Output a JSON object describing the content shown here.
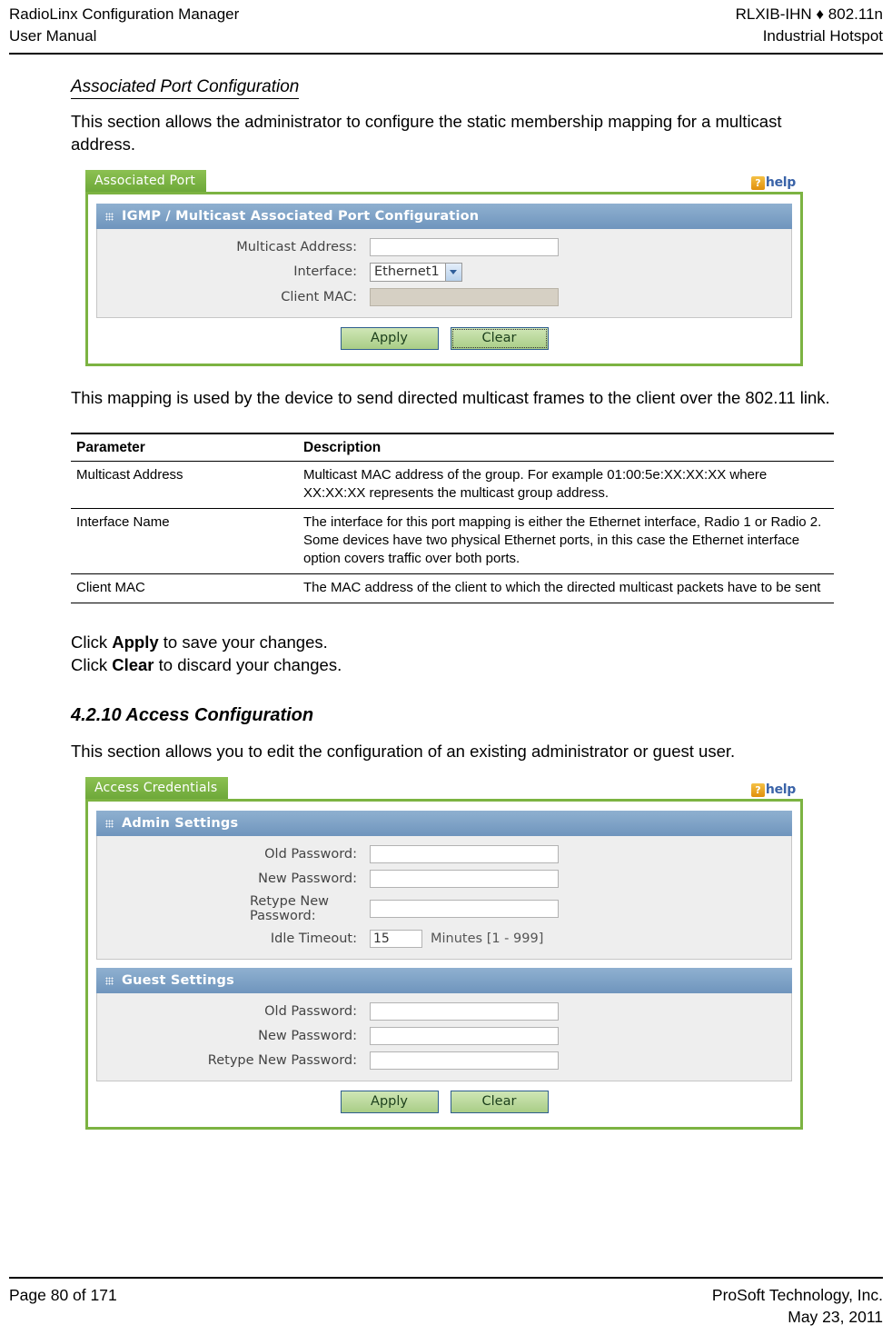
{
  "header": {
    "left_line1": "RadioLinx Configuration Manager",
    "left_line2": "User Manual",
    "right_line1": "RLXIB-IHN ♦ 802.11n",
    "right_line2": "Industrial Hotspot"
  },
  "body": {
    "subheading": "Associated Port Configuration",
    "intro_paragraph": "This section allows the administrator to configure the static membership mapping for a multicast address.",
    "mapping_paragraph": "This mapping is used by the device to send directed multicast frames to the client over the 802.11 link.",
    "click_apply_prefix": "Click ",
    "click_apply_bold": "Apply",
    "click_apply_suffix": " to save your changes.",
    "click_clear_prefix": "Click ",
    "click_clear_bold": "Clear",
    "click_clear_suffix": " to discard your changes.",
    "section_heading": "4.2.10 Access Configuration",
    "access_paragraph": "This section allows you to edit the configuration of an existing administrator or guest user."
  },
  "screenshot_associated_port": {
    "tab_label": "Associated Port",
    "help_badge": "?",
    "help_label": "help",
    "panel_title": "IGMP / Multicast Associated Port Configuration",
    "fields": [
      {
        "label": "Multicast Address:",
        "type": "text",
        "value": "",
        "disabled": false
      },
      {
        "label": "Interface:",
        "type": "select",
        "value": "Ethernet1",
        "disabled": false
      },
      {
        "label": "Client MAC:",
        "type": "text",
        "value": "",
        "disabled": true
      }
    ],
    "buttons": [
      {
        "label": "Apply",
        "focused": false
      },
      {
        "label": "Clear",
        "focused": true
      }
    ]
  },
  "screenshot_access_credentials": {
    "tab_label": "Access Credentials",
    "help_badge": "?",
    "help_label": "help",
    "admin": {
      "panel_title": "Admin Settings",
      "fields": [
        {
          "label": "Old Password:",
          "type": "text",
          "value": ""
        },
        {
          "label": "New Password:",
          "type": "text",
          "value": ""
        },
        {
          "label": "Retype New Password:",
          "type": "text",
          "value": ""
        },
        {
          "label": "Idle Timeout:",
          "type": "number",
          "value": "15",
          "suffix": "Minutes [1 - 999]"
        }
      ]
    },
    "guest": {
      "panel_title": "Guest Settings",
      "fields": [
        {
          "label": "Old Password:",
          "type": "text",
          "value": ""
        },
        {
          "label": "New Password:",
          "type": "text",
          "value": ""
        },
        {
          "label": "Retype New Password:",
          "type": "text",
          "value": ""
        }
      ]
    },
    "buttons": [
      {
        "label": "Apply",
        "focused": false
      },
      {
        "label": "Clear",
        "focused": false
      }
    ]
  },
  "param_table": {
    "headers": {
      "parameter": "Parameter",
      "description": "Description"
    },
    "rows": [
      {
        "parameter": "Multicast Address",
        "description": "Multicast MAC address of the group. For example 01:00:5e:XX:XX:XX where XX:XX:XX represents the multicast group address."
      },
      {
        "parameter": "Interface Name",
        "description": "The interface for this port mapping is either the Ethernet interface, Radio 1 or Radio 2. Some devices have two physical Ethernet ports, in this case the Ethernet interface option covers traffic over both ports."
      },
      {
        "parameter": "Client MAC",
        "description": "The MAC address of the client to which the directed multicast packets have to be sent"
      }
    ]
  },
  "footer": {
    "page_number": "Page 80 of 171",
    "company": "ProSoft Technology, Inc.",
    "date": "May 23, 2011"
  },
  "colors": {
    "tab_green": "#7cb342",
    "panel_blue": "#7ea2c6",
    "help_orange": "#f0a91e",
    "help_blue_text": "#3a63a8",
    "button_green": "#b9d79a",
    "disabled_field": "#d6d0c4"
  }
}
